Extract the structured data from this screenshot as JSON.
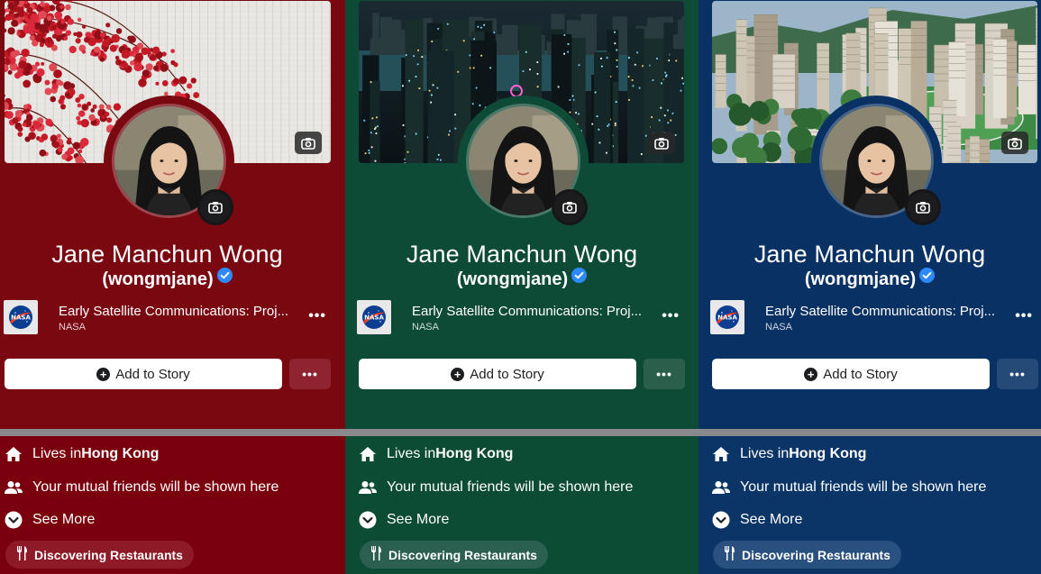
{
  "panels": [
    {
      "theme": "red",
      "colors": {
        "upper": "#790811",
        "lower": "#79000c",
        "more_btn": "#8f2330",
        "chip": "#8d1a26"
      },
      "cover_scene": "red-foliage-wall",
      "name": "Jane Manchun Wong",
      "handle": "(wongmjane)",
      "music_title": "Early Satellite Communications: Proj...",
      "music_artist": "NASA",
      "add_story_label": "Add to Story",
      "more_label": "•••",
      "lives_prefix": "Lives in ",
      "lives_city": "Hong Kong",
      "friends_text": "Your mutual friends will be shown here",
      "see_more": "See More",
      "chip_label": "Discovering Restaurants"
    },
    {
      "theme": "green",
      "colors": {
        "upper": "#0e4b36",
        "lower": "#0c4b34",
        "more_btn": "#2a5f4b",
        "chip": "#2b6050"
      },
      "cover_scene": "hong-kong-night-skyline",
      "name": "Jane Manchun Wong",
      "handle": "(wongmjane)",
      "music_title": "Early Satellite Communications: Proj...",
      "music_artist": "NASA",
      "add_story_label": "Add to Story",
      "more_label": "•••",
      "lives_prefix": "Lives in ",
      "lives_city": "Hong Kong",
      "friends_text": "Your mutual friends will be shown here",
      "see_more": "See More",
      "chip_label": "Discovering Restaurants"
    },
    {
      "theme": "blue",
      "colors": {
        "upper": "#0a3163",
        "lower": "#0b3566",
        "more_btn": "#254a78",
        "chip": "#29507e"
      },
      "cover_scene": "hong-kong-day-skyline",
      "name": "Jane Manchun Wong",
      "handle": "(wongmjane)",
      "music_title": "Early Satellite Communications: Proj...",
      "music_artist": "NASA",
      "add_story_label": "Add to Story",
      "more_label": "•••",
      "lives_prefix": "Lives in ",
      "lives_city": "Hong Kong",
      "friends_text": "Your mutual friends will be shown here",
      "see_more": "See More",
      "chip_label": "Discovering Restaurants"
    }
  ]
}
